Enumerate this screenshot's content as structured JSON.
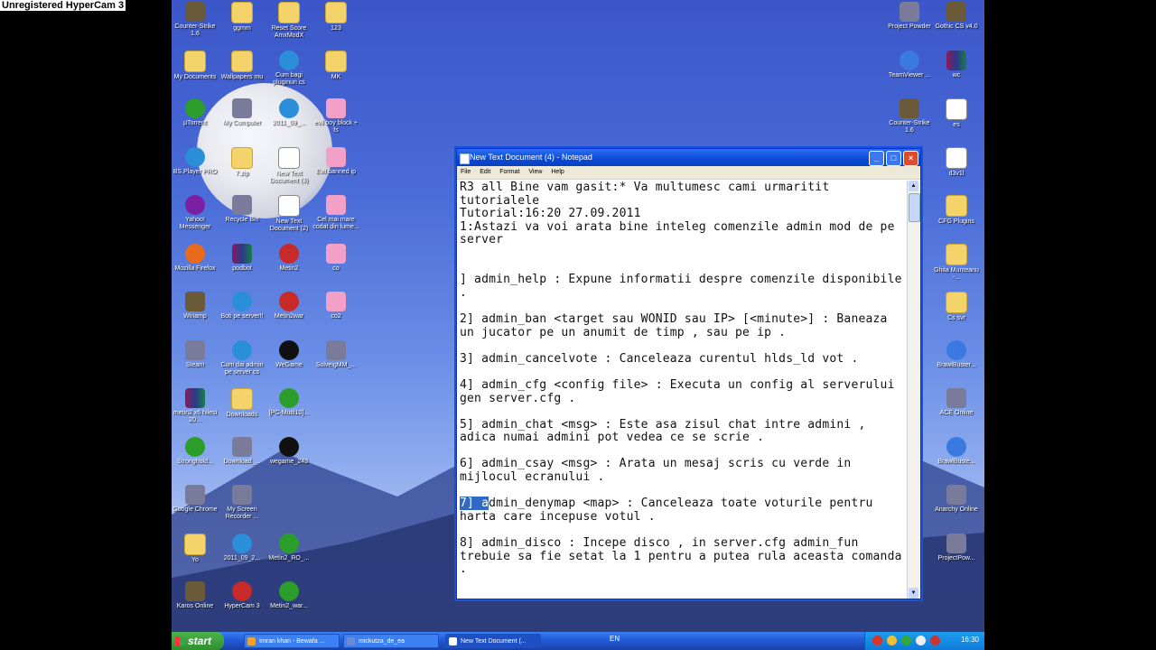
{
  "watermark": "Unregistered HyperCam 3",
  "desktop_icons_left": [
    {
      "label": "Counter-Strike 1.6",
      "icon": "game-icon",
      "g": "g-game",
      "col": 0,
      "row": 0
    },
    {
      "label": "ggmm",
      "icon": "folder-icon",
      "g": "g-folder",
      "col": 1,
      "row": 0
    },
    {
      "label": "Reset Score AmxModX",
      "icon": "folder-icon",
      "g": "g-folder",
      "col": 2,
      "row": 0
    },
    {
      "label": "123",
      "icon": "folder-icon",
      "g": "g-folder",
      "col": 3,
      "row": 0
    },
    {
      "label": "My Documents",
      "icon": "folder-icon",
      "g": "g-folder",
      "col": 0,
      "row": 1
    },
    {
      "label": "Wallpapers mu",
      "icon": "folder-icon",
      "g": "g-folder",
      "col": 1,
      "row": 1
    },
    {
      "label": "Cum bagi pluginuri cs",
      "icon": "bsplayer-icon",
      "g": "g-bs",
      "col": 2,
      "row": 1
    },
    {
      "label": "MK",
      "icon": "folder-icon",
      "g": "g-folder",
      "col": 3,
      "row": 1
    },
    {
      "label": "µTorrent",
      "icon": "utorrent-icon",
      "g": "g-utor",
      "col": 0,
      "row": 2
    },
    {
      "label": "My Computer",
      "icon": "computer-icon",
      "g": "g-app",
      "col": 1,
      "row": 2
    },
    {
      "label": "2011_09_...",
      "icon": "bsplayer-icon",
      "g": "g-bs",
      "col": 2,
      "row": 2
    },
    {
      "label": "evil boy block + fs",
      "icon": "shortcut-icon",
      "g": "g-pink",
      "col": 3,
      "row": 2
    },
    {
      "label": "BS.Player PRO",
      "icon": "bsplayer-icon",
      "g": "g-bs",
      "col": 0,
      "row": 3
    },
    {
      "label": "7.zip",
      "icon": "folder-icon",
      "g": "g-folder",
      "col": 1,
      "row": 3
    },
    {
      "label": "New Text Document (3)",
      "icon": "document-icon",
      "g": "g-doc",
      "col": 2,
      "row": 3
    },
    {
      "label": "Evil banned ip",
      "icon": "shortcut-icon",
      "g": "g-pink",
      "col": 3,
      "row": 3
    },
    {
      "label": "Yahoo! Messenger",
      "icon": "yahoo-icon",
      "g": "g-yah",
      "col": 0,
      "row": 4
    },
    {
      "label": "Recycle Bin",
      "icon": "recycle-bin-icon",
      "g": "g-app",
      "col": 1,
      "row": 4
    },
    {
      "label": "New Text Document (2)",
      "icon": "document-icon",
      "g": "g-doc",
      "col": 2,
      "row": 4
    },
    {
      "label": "Cel mai mare codat din lume...",
      "icon": "shortcut-icon",
      "g": "g-pink",
      "col": 3,
      "row": 4
    },
    {
      "label": "Mozilla Firefox",
      "icon": "firefox-icon",
      "g": "g-ff",
      "col": 0,
      "row": 5
    },
    {
      "label": "podbot",
      "icon": "winrar-icon",
      "g": "g-rar",
      "col": 1,
      "row": 5
    },
    {
      "label": "Metin2",
      "icon": "metin2-icon",
      "g": "g-red",
      "col": 2,
      "row": 5
    },
    {
      "label": "co",
      "icon": "shortcut-icon",
      "g": "g-pink",
      "col": 3,
      "row": 5
    },
    {
      "label": "Winamp",
      "icon": "winamp-icon",
      "g": "g-game",
      "col": 0,
      "row": 6
    },
    {
      "label": "Boti pe server!!",
      "icon": "bsplayer-icon",
      "g": "g-bs",
      "col": 1,
      "row": 6
    },
    {
      "label": "Metin2war",
      "icon": "metin2-icon",
      "g": "g-red",
      "col": 2,
      "row": 6
    },
    {
      "label": "co2",
      "icon": "shortcut-icon",
      "g": "g-pink",
      "col": 3,
      "row": 6
    },
    {
      "label": "Steam",
      "icon": "steam-icon",
      "g": "g-app",
      "col": 0,
      "row": 7
    },
    {
      "label": "Cum dai admin pe server cs",
      "icon": "bsplayer-icon",
      "g": "g-bs",
      "col": 1,
      "row": 7
    },
    {
      "label": "WeGame",
      "icon": "wegame-icon",
      "g": "g-black",
      "col": 2,
      "row": 7
    },
    {
      "label": "SolveigMM_...",
      "icon": "app-icon",
      "g": "g-app",
      "col": 3,
      "row": 7
    },
    {
      "label": "metin2 x6 hilesi 20...",
      "icon": "winrar-icon",
      "g": "g-rar",
      "col": 0,
      "row": 8
    },
    {
      "label": "Downloads",
      "icon": "folder-icon",
      "g": "g-folder",
      "col": 1,
      "row": 8
    },
    {
      "label": "[PC-Multi10]...",
      "icon": "utorrent-icon",
      "g": "g-utor",
      "col": 2,
      "row": 8
    },
    {
      "label": "Stronghold...",
      "icon": "utorrent-icon",
      "g": "g-utor",
      "col": 0,
      "row": 9
    },
    {
      "label": "Download_...",
      "icon": "app-icon",
      "g": "g-app",
      "col": 1,
      "row": 9
    },
    {
      "label": "wegame_243",
      "icon": "wegame-icon",
      "g": "g-black",
      "col": 2,
      "row": 9
    },
    {
      "label": "Google Chrome",
      "icon": "window-icon",
      "g": "g-app",
      "col": 0,
      "row": 10
    },
    {
      "label": "My Screen Recorder ...",
      "icon": "recorder-icon",
      "g": "g-app",
      "col": 1,
      "row": 10
    },
    {
      "label": "Yo",
      "icon": "folder-icon",
      "g": "g-folder",
      "col": 0,
      "row": 11
    },
    {
      "label": "2011_09_2...",
      "icon": "bsplayer-icon",
      "g": "g-bs",
      "col": 1,
      "row": 11
    },
    {
      "label": "Metin2_RO_...",
      "icon": "utorrent-icon",
      "g": "g-utor",
      "col": 2,
      "row": 11
    },
    {
      "label": "Karos Online",
      "icon": "game-icon",
      "g": "g-game",
      "col": 0,
      "row": 12
    },
    {
      "label": "HyperCam 3",
      "icon": "hypercam-icon",
      "g": "g-red",
      "col": 1,
      "row": 12
    },
    {
      "label": "Metin2_war...",
      "icon": "utorrent-icon",
      "g": "g-utor",
      "col": 2,
      "row": 12
    }
  ],
  "desktop_icons_right": [
    {
      "label": "Project Powder",
      "icon": "app-icon",
      "g": "g-app",
      "col": 0,
      "row": 0
    },
    {
      "label": "Gothic CS v4.0",
      "icon": "game-icon",
      "g": "g-game",
      "col": 1,
      "row": 0
    },
    {
      "label": "TeamViewer ...",
      "icon": "teamviewer-icon",
      "g": "g-blue",
      "col": 0,
      "row": 1
    },
    {
      "label": "wc",
      "icon": "winrar-icon",
      "g": "g-rar",
      "col": 1,
      "row": 1
    },
    {
      "label": "Counter-Strike 1.6",
      "icon": "game-icon",
      "g": "g-game",
      "col": 0,
      "row": 2
    },
    {
      "label": "es",
      "icon": "document-icon",
      "g": "g-doc",
      "col": 1,
      "row": 2
    },
    {
      "label": "d3v1l",
      "icon": "document-icon",
      "g": "g-doc",
      "col": 1,
      "row": 3
    },
    {
      "label": "CFG Plugins",
      "icon": "folder-icon",
      "g": "g-folder",
      "col": 1,
      "row": 4
    },
    {
      "label": "Ghita Munteanu -...",
      "icon": "folder-icon",
      "g": "g-folder",
      "col": 1,
      "row": 5
    },
    {
      "label": "Cs svr",
      "icon": "folder-icon",
      "g": "g-folder",
      "col": 1,
      "row": 6
    },
    {
      "label": "BrawlBuster...",
      "icon": "brawlbuster-icon",
      "g": "g-blue",
      "col": 1,
      "row": 7
    },
    {
      "label": "ACE Online",
      "icon": "ace-online-icon",
      "g": "g-app",
      "col": 1,
      "row": 8
    },
    {
      "label": "BrawlBuste...",
      "icon": "brawlbuster-icon",
      "g": "g-blue",
      "col": 1,
      "row": 9
    },
    {
      "label": "Anarchy Online",
      "icon": "anarchy-icon",
      "g": "g-app",
      "col": 1,
      "row": 10
    },
    {
      "label": "ProjectPow...",
      "icon": "app-icon",
      "g": "g-app",
      "col": 1,
      "row": 11
    }
  ],
  "notepad": {
    "title": "New Text Document (4) - Notepad",
    "menu": [
      "File",
      "Edit",
      "Format",
      "View",
      "Help"
    ],
    "text_before_selection": "R3 all Bine vam gasit:* Va multumesc cami urmaritit tutorialele\nTutorial:16:20 27.09.2011\n1:Astazi va voi arata bine inteleg comenzile admin mod de pe server\n\n\n] admin_help : Expune informatii despre comenzile disponibile .\n\n2] admin_ban <target sau WONID sau IP> [<minute>] : Baneaza un jucator pe un anumit de timp , sau pe ip .\n\n3] admin_cancelvote : Canceleaza curentul hlds_ld vot .\n\n4] admin_cfg <config file> : Executa un config al serverului gen server.cfg .\n\n5] admin_chat <msg> : Este asa zisul chat intre admini , adica numai admini pot vedea ce se scrie .\n\n6] admin_csay <msg> : Arata un mesaj scris cu verde in mijlocul ecranului .\n\n",
    "selected_text": "7] a",
    "text_after_selection": "dmin_denymap <map> : Canceleaza toate voturile pentru harta care incepuse votul .\n\n8] admin_disco : Incepe disco , in server.cfg admin_fun trebuie sa fie setat la 1 pentru a putea rula aceasta comanda ."
  },
  "taskbar": {
    "start_label": "start",
    "tasks": [
      {
        "label": "Imran khan - Bewafa ...",
        "active": false
      },
      {
        "label": "mickutza_de_ea",
        "active": false
      },
      {
        "label": "New Text Document (...",
        "active": true
      }
    ],
    "language": "EN",
    "clock": "16:30"
  },
  "colors": {
    "titlebar": "#0a4ad6",
    "taskbar": "#245edb",
    "start": "#2f8f2f",
    "selection": "#316ac5"
  }
}
